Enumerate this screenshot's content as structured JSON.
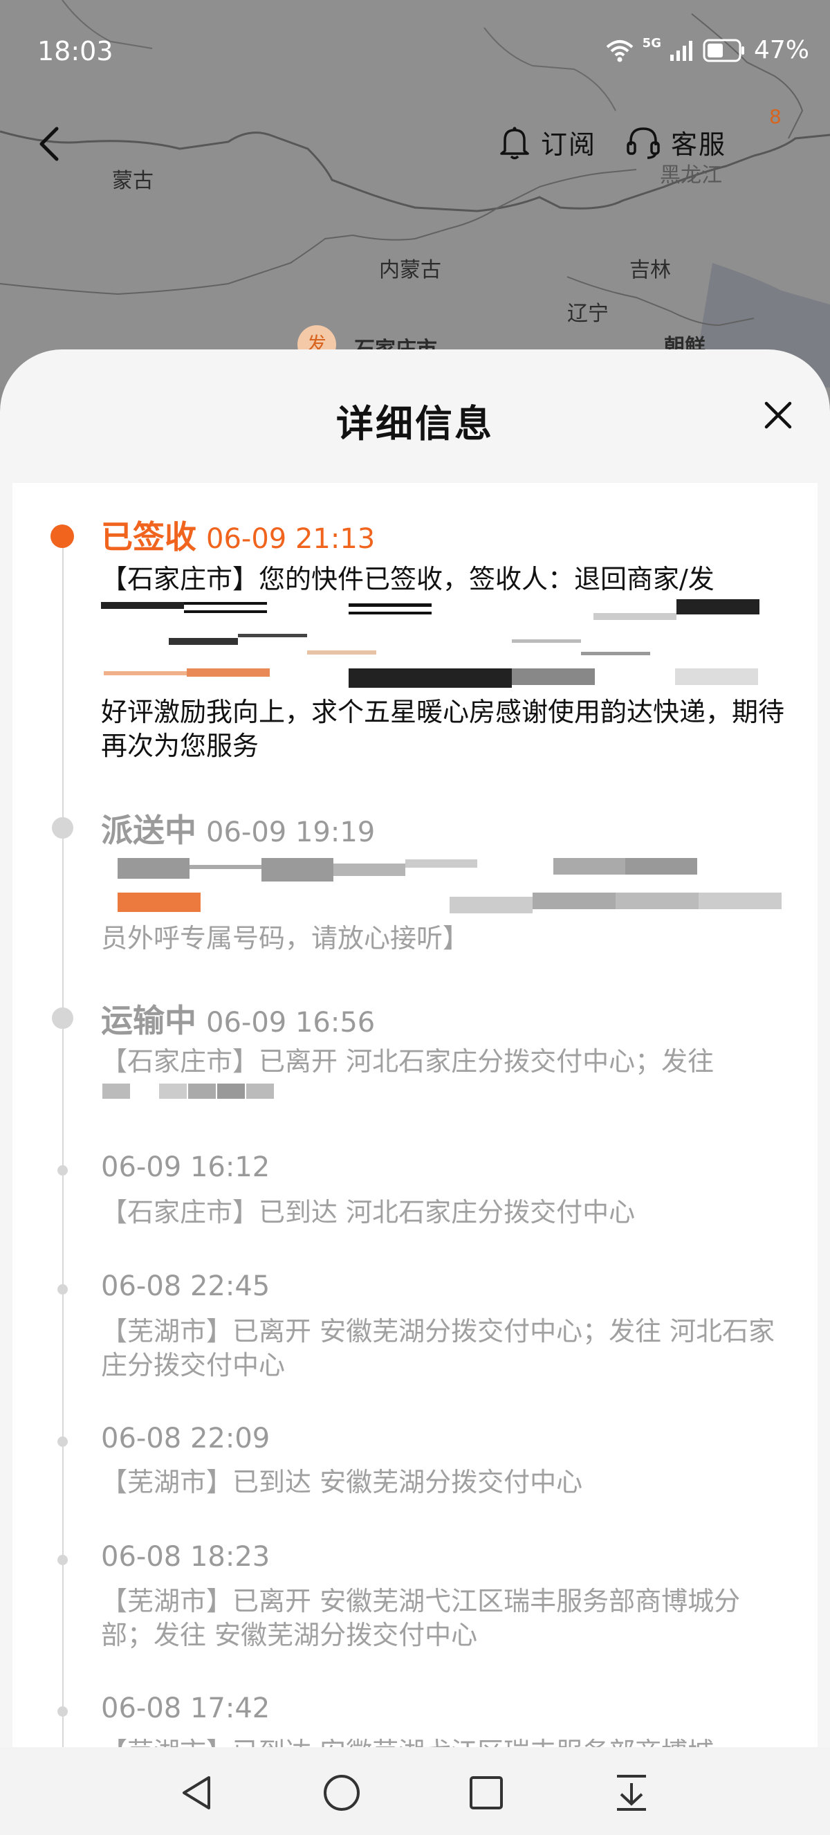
{
  "status_bar": {
    "time": "18:03",
    "network": "5G",
    "battery": "47%"
  },
  "map": {
    "labels": [
      "蒙古",
      "内蒙古",
      "吉林",
      "辽宁",
      "黑龙江",
      "石家庄市",
      "朝鲜"
    ],
    "origin_badge": "发",
    "corner_badge": "8"
  },
  "top_nav": {
    "subscribe_label": "订阅",
    "service_label": "客服"
  },
  "sheet": {
    "title": "详细信息"
  },
  "timeline": [
    {
      "status": "已签收",
      "time": "06-09 21:13",
      "text_top": "【石家庄市】您的快件已签收，签收人：退回商家/发",
      "text_bottom": "好评激励我向上，求个五星暖心房感谢使用韵达快递，期待再次为您服务"
    },
    {
      "status": "派送中",
      "time": "06-09 19:19",
      "text_bottom": "员外呼专属号码，请放心接听】"
    },
    {
      "status": "运输中",
      "time": "06-09 16:56",
      "text_top": "【石家庄市】已离开 河北石家庄分拨交付中心；发往"
    },
    {
      "time": "06-09 16:12",
      "text": "【石家庄市】已到达 河北石家庄分拨交付中心"
    },
    {
      "time": "06-08 22:45",
      "text": "【芜湖市】已离开 安徽芜湖分拨交付中心；发往 河北石家庄分拨交付中心"
    },
    {
      "time": "06-08 22:09",
      "text": "【芜湖市】已到达 安徽芜湖分拨交付中心"
    },
    {
      "time": "06-08 18:23",
      "text": "【芜湖市】已离开 安徽芜湖弋江区瑞丰服务部商博城分部；发往 安徽芜湖分拨交付中心"
    },
    {
      "time": "06-08 17:42",
      "text": "【芜湖市】已到达 安徽芜湖弋江区瑞丰服务部商博城"
    }
  ],
  "colors": {
    "accent": "#f0641e",
    "muted_text": "#a0a0a0",
    "timeline_dot": "#d6d6d6"
  },
  "icons": {
    "back": "chevron-left-icon",
    "subscribe": "bell-icon",
    "service": "headset-icon",
    "close": "close-icon",
    "nav_back": "triangle-back-icon",
    "nav_home": "circle-home-icon",
    "nav_recents": "square-recents-icon",
    "nav_down": "pull-down-icon"
  }
}
